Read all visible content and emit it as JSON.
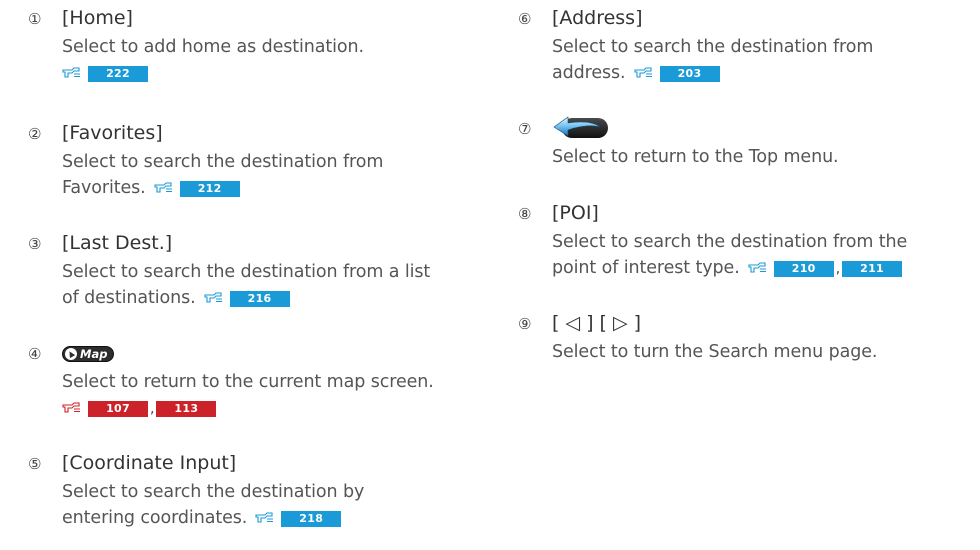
{
  "accent": {
    "badge_blue": "#1a9ad6",
    "badge_red": "#cc2229"
  },
  "items": [
    {
      "num": "①",
      "title": "[Home]",
      "lines": [
        "Select to add home as destination."
      ],
      "refs": [
        {
          "page": "222",
          "color": "blue"
        }
      ]
    },
    {
      "num": "②",
      "title": "[Favorites]",
      "lines": [
        "Select to search the destination from",
        "Favorites."
      ],
      "refs": [
        {
          "page": "212",
          "color": "blue"
        }
      ]
    },
    {
      "num": "③",
      "title": "[Last Dest.]",
      "lines": [
        "Select to search the destination from a list",
        "of destinations."
      ],
      "refs": [
        {
          "page": "216",
          "color": "blue"
        }
      ]
    },
    {
      "num": "④",
      "icon": "map-button-icon",
      "icon_label": "Map",
      "lines": [
        "Select to return to the current map screen."
      ],
      "refs": [
        {
          "page": "107",
          "color": "red"
        },
        {
          "page": "113",
          "color": "red"
        }
      ],
      "ref_sep": ","
    },
    {
      "num": "⑤",
      "title": "[Coordinate Input]",
      "lines": [
        "Select to search the destination by",
        "entering coordinates."
      ],
      "refs": [
        {
          "page": "218",
          "color": "blue"
        }
      ]
    },
    {
      "num": "⑥",
      "title": "[Address]",
      "lines": [
        "Select to search the destination from",
        "address."
      ],
      "refs": [
        {
          "page": "203",
          "color": "blue"
        }
      ]
    },
    {
      "num": "⑦",
      "icon": "back-arrow-icon",
      "lines": [
        "Select to return to the Top menu."
      ]
    },
    {
      "num": "⑧",
      "title": "[POI]",
      "lines": [
        "Select to search the destination from the",
        "point of interest type."
      ],
      "refs": [
        {
          "page": "210",
          "color": "blue"
        },
        {
          "page": "211",
          "color": "blue"
        }
      ],
      "ref_sep": ","
    },
    {
      "num": "⑨",
      "title": "[ ◁ ] [ ▷ ]",
      "lines": [
        "Select to turn the Search menu page."
      ]
    }
  ]
}
